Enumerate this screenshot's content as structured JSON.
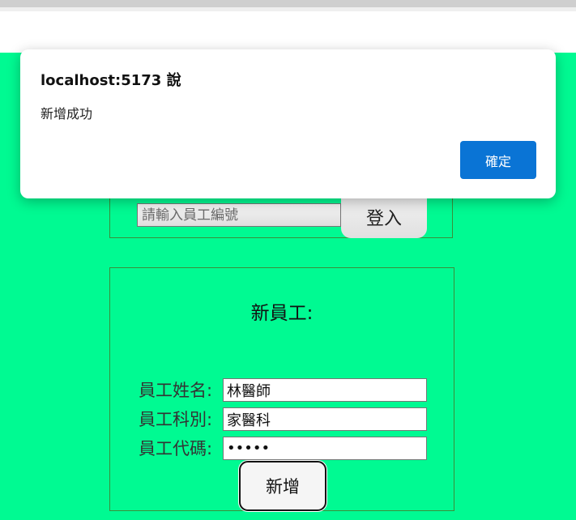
{
  "dialog": {
    "title": "localhost:5173 說",
    "message": "新增成功",
    "ok_label": "確定"
  },
  "login": {
    "employee_id_placeholder": "請輸入員工編號",
    "login_label": "登入"
  },
  "new_employee": {
    "title": "新員工:",
    "fields": [
      {
        "label": "員工姓名:",
        "value": "林醫師"
      },
      {
        "label": "員工科別:",
        "value": "家醫科"
      },
      {
        "label": "員工代碼:",
        "value": "12345"
      }
    ],
    "add_label": "新增"
  }
}
